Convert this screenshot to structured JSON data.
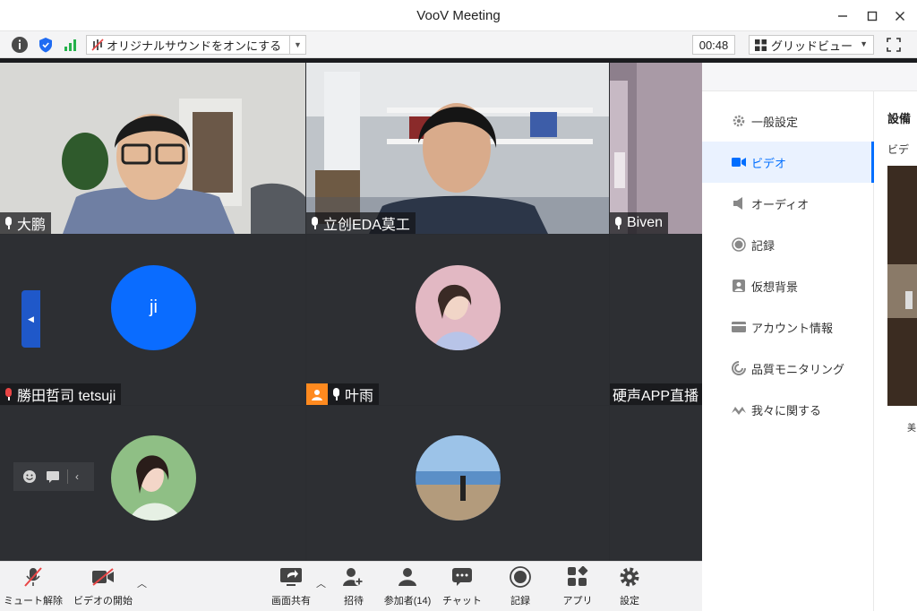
{
  "window": {
    "title": "VooV Meeting"
  },
  "toolbar": {
    "sound_label": "オリジナルサウンドをオンにする",
    "timer": "00:48",
    "grid_view_label": "グリッドビュー"
  },
  "participants": [
    {
      "name": "大鹏",
      "mic": "on"
    },
    {
      "name": "立创EDA莫工",
      "mic": "on"
    },
    {
      "name": "Biven",
      "mic": "on"
    },
    {
      "name": "勝田哲司 tetsuji",
      "mic": "muted",
      "avatar_text": "ji"
    },
    {
      "name": "叶雨",
      "mic": "on"
    },
    {
      "name": "硬声APP直播",
      "mic": "none"
    }
  ],
  "settings": {
    "nav": [
      {
        "label": "一般設定",
        "icon": "gear-icon"
      },
      {
        "label": "ビデオ",
        "icon": "video-camera-icon"
      },
      {
        "label": "オーディオ",
        "icon": "speaker-icon"
      },
      {
        "label": "記録",
        "icon": "record-icon"
      },
      {
        "label": "仮想背景",
        "icon": "portrait-icon"
      },
      {
        "label": "アカウント情報",
        "icon": "card-icon"
      },
      {
        "label": "品質モニタリング",
        "icon": "gauge-icon"
      },
      {
        "label": "我々に関する",
        "icon": "logo-icon"
      }
    ],
    "active": "ビデオ",
    "content_heading": "設備",
    "content_sub": "ビデ",
    "content_footer": "美"
  },
  "bottom": {
    "unmute": "ミュート解除",
    "start_video": "ビデオの開始",
    "share": "画面共有",
    "invite": "招待",
    "participants": "参加者(14)",
    "chat": "チャット",
    "record": "記録",
    "apps": "アプリ",
    "settings": "設定"
  },
  "colors": {
    "accent": "#006eff",
    "avatar_blue": "#0a6cff",
    "muted_red": "#e84545",
    "handle_blue": "#1f58c9"
  }
}
